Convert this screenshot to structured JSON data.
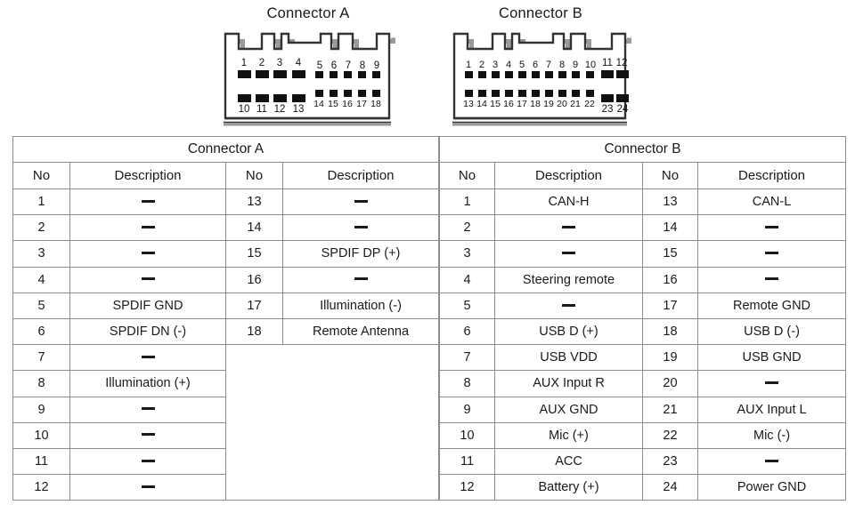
{
  "figures": {
    "connector_a": {
      "caption": "Connector A",
      "top_row_large": [
        "1",
        "2",
        "3",
        "4"
      ],
      "top_row_small": [
        "5",
        "6",
        "7",
        "8",
        "9"
      ],
      "bottom_row_large": [
        "10",
        "11",
        "12",
        "13"
      ],
      "bottom_row_small": [
        "14",
        "15",
        "16",
        "17",
        "18"
      ]
    },
    "connector_b": {
      "caption": "Connector B",
      "top_row_small": [
        "1",
        "2",
        "3",
        "4",
        "5",
        "6",
        "7",
        "8",
        "9",
        "10"
      ],
      "top_row_large": [
        "11",
        "12"
      ],
      "bottom_row_small": [
        "13",
        "14",
        "15",
        "16",
        "17",
        "18",
        "19",
        "20",
        "21",
        "22"
      ],
      "bottom_row_large": [
        "23",
        "24"
      ]
    }
  },
  "tables": {
    "connector_a": {
      "title": "Connector A",
      "headers": [
        "No",
        "Description",
        "No",
        "Description"
      ],
      "rows": [
        {
          "no_left": "1",
          "desc_left": "—",
          "no_right": "13",
          "desc_right": "—"
        },
        {
          "no_left": "2",
          "desc_left": "—",
          "no_right": "14",
          "desc_right": "—"
        },
        {
          "no_left": "3",
          "desc_left": "—",
          "no_right": "15",
          "desc_right": "SPDIF DP (+)"
        },
        {
          "no_left": "4",
          "desc_left": "—",
          "no_right": "16",
          "desc_right": "—"
        },
        {
          "no_left": "5",
          "desc_left": "SPDIF GND",
          "no_right": "17",
          "desc_right": "Illumination (-)"
        },
        {
          "no_left": "6",
          "desc_left": "SPDIF DN (-)",
          "no_right": "18",
          "desc_right": "Remote Antenna"
        },
        {
          "no_left": "7",
          "desc_left": "—",
          "no_right": "",
          "desc_right": ""
        },
        {
          "no_left": "8",
          "desc_left": "Illumination (+)",
          "no_right": "",
          "desc_right": ""
        },
        {
          "no_left": "9",
          "desc_left": "—",
          "no_right": "",
          "desc_right": ""
        },
        {
          "no_left": "10",
          "desc_left": "—",
          "no_right": "",
          "desc_right": ""
        },
        {
          "no_left": "11",
          "desc_left": "—",
          "no_right": "",
          "desc_right": ""
        },
        {
          "no_left": "12",
          "desc_left": "—",
          "no_right": "",
          "desc_right": ""
        }
      ]
    },
    "connector_b": {
      "title": "Connector B",
      "headers": [
        "No",
        "Description",
        "No",
        "Description"
      ],
      "rows": [
        {
          "no_left": "1",
          "desc_left": "CAN-H",
          "no_right": "13",
          "desc_right": "CAN-L"
        },
        {
          "no_left": "2",
          "desc_left": "—",
          "no_right": "14",
          "desc_right": "—"
        },
        {
          "no_left": "3",
          "desc_left": "—",
          "no_right": "15",
          "desc_right": "—"
        },
        {
          "no_left": "4",
          "desc_left": "Steering remote",
          "no_right": "16",
          "desc_right": "—"
        },
        {
          "no_left": "5",
          "desc_left": "—",
          "no_right": "17",
          "desc_right": "Remote GND"
        },
        {
          "no_left": "6",
          "desc_left": "USB D (+)",
          "no_right": "18",
          "desc_right": "USB D (-)"
        },
        {
          "no_left": "7",
          "desc_left": "USB VDD",
          "no_right": "19",
          "desc_right": "USB GND"
        },
        {
          "no_left": "8",
          "desc_left": "AUX Input R",
          "no_right": "20",
          "desc_right": "—"
        },
        {
          "no_left": "9",
          "desc_left": "AUX GND",
          "no_right": "21",
          "desc_right": "AUX Input L"
        },
        {
          "no_left": "10",
          "desc_left": "Mic (+)",
          "no_right": "22",
          "desc_right": "Mic (-)"
        },
        {
          "no_left": "11",
          "desc_left": "ACC",
          "no_right": "23",
          "desc_right": "—"
        },
        {
          "no_left": "12",
          "desc_left": "Battery (+)",
          "no_right": "24",
          "desc_right": "Power GND"
        }
      ]
    }
  },
  "colors": {
    "pin_fill": "#111111",
    "shell_stroke": "#333333",
    "shell_shadow": "#9a9a9a",
    "table_border": "#8d8d8d",
    "background": "#ffffff"
  }
}
